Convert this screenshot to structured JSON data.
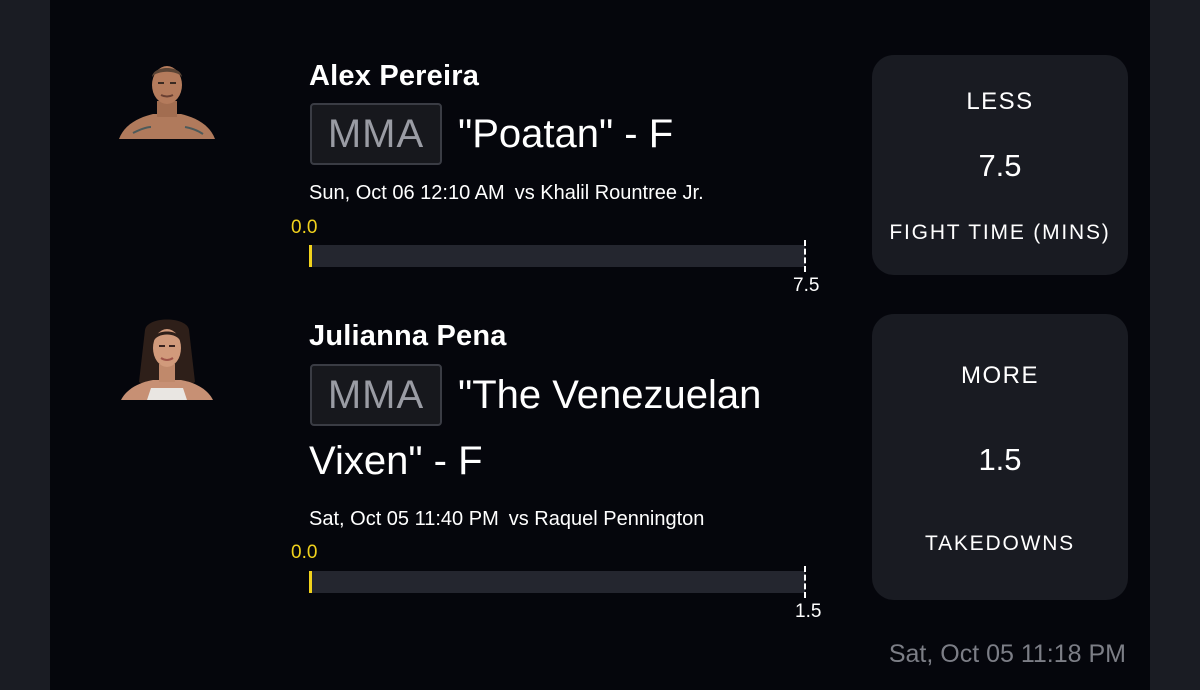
{
  "picks": [
    {
      "name": "Alex Pereira",
      "league": "MMA",
      "nickname": "\"Poatan\" - F",
      "datetime": "Sun, Oct 06 12:10 AM",
      "opponent": "vs Khalil Rountree Jr.",
      "progress_start": "0.0",
      "progress_current": 0.0,
      "line_label": "7.5",
      "choice": "LESS",
      "line": "7.5",
      "stat": "FIGHT TIME (MINS)"
    },
    {
      "name": "Julianna Pena",
      "league": "MMA",
      "nickname_line1": "\"The Venezuelan",
      "nickname_line2": "Vixen\" - F",
      "datetime": "Sat, Oct 05 11:40 PM",
      "opponent": "vs Raquel Pennington",
      "progress_start": "0.0",
      "progress_current": 0.0,
      "line_label": "1.5",
      "choice": "MORE",
      "line": "1.5",
      "stat": "TAKEDOWNS"
    }
  ],
  "footer": {
    "timestamp": "Sat, Oct 05 11:18 PM"
  },
  "colors": {
    "accent": "#f1d21c",
    "panel": "#05060c",
    "card": "#191b22",
    "track": "#24262f"
  }
}
